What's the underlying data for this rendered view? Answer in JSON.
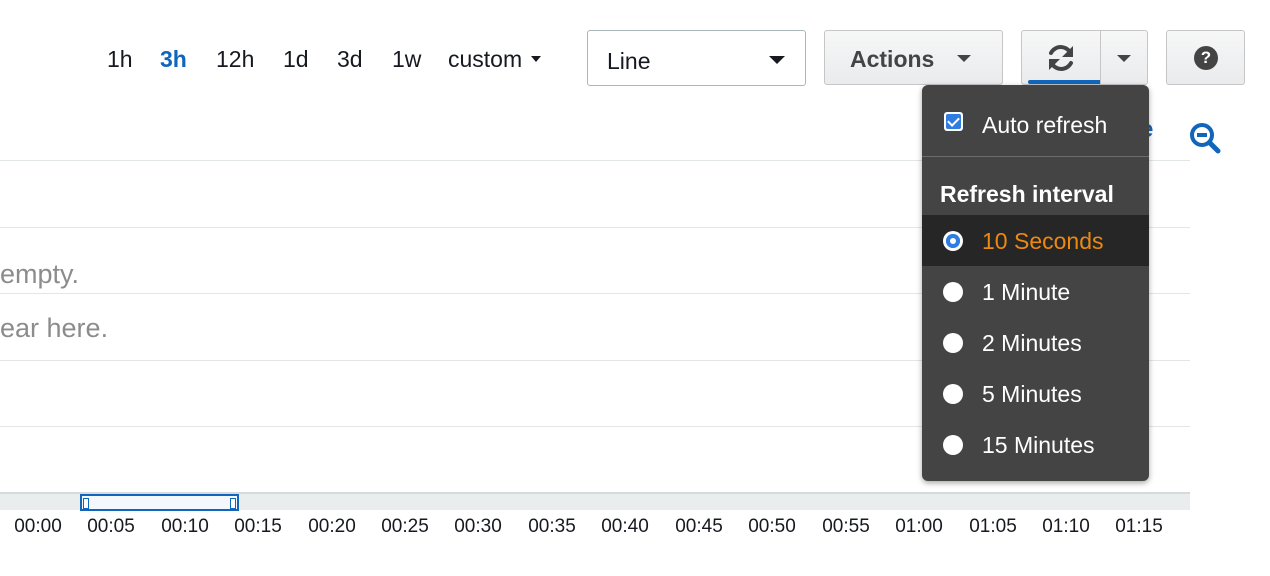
{
  "toolbar": {
    "time_ranges": [
      {
        "label": "1h",
        "active": false
      },
      {
        "label": "3h",
        "active": true
      },
      {
        "label": "12h",
        "active": false
      },
      {
        "label": "1d",
        "active": false
      },
      {
        "label": "3d",
        "active": false
      },
      {
        "label": "1w",
        "active": false
      }
    ],
    "custom_label": "custom",
    "graph_type": {
      "selected": "Line"
    },
    "actions_label": "Actions",
    "refresh_icon": "refresh-icon",
    "help_icon": "help-icon",
    "help_glyph": "?"
  },
  "graph": {
    "empty_line_1": "empty.",
    "empty_line_2": "ear here.",
    "peek_text": "e",
    "zoom_icon": "zoom-out-icon",
    "x_ticks": [
      "00:00",
      "00:05",
      "00:10",
      "00:15",
      "00:20",
      "00:25",
      "00:30",
      "00:35",
      "00:40",
      "00:45",
      "00:50",
      "00:55",
      "01:00",
      "01:05",
      "01:10",
      "01:15"
    ]
  },
  "refresh_menu": {
    "auto_refresh_label": "Auto refresh",
    "auto_refresh_checked": true,
    "interval_header": "Refresh interval",
    "intervals": [
      {
        "label": "10 Seconds",
        "selected": true
      },
      {
        "label": "1 Minute",
        "selected": false
      },
      {
        "label": "2 Minutes",
        "selected": false
      },
      {
        "label": "5 Minutes",
        "selected": false
      },
      {
        "label": "15 Minutes",
        "selected": false
      }
    ]
  },
  "colors": {
    "accent": "#1166bb",
    "selected_text": "#ec8911",
    "menu_bg": "#444444",
    "radio_blue": "#2f7de1"
  }
}
